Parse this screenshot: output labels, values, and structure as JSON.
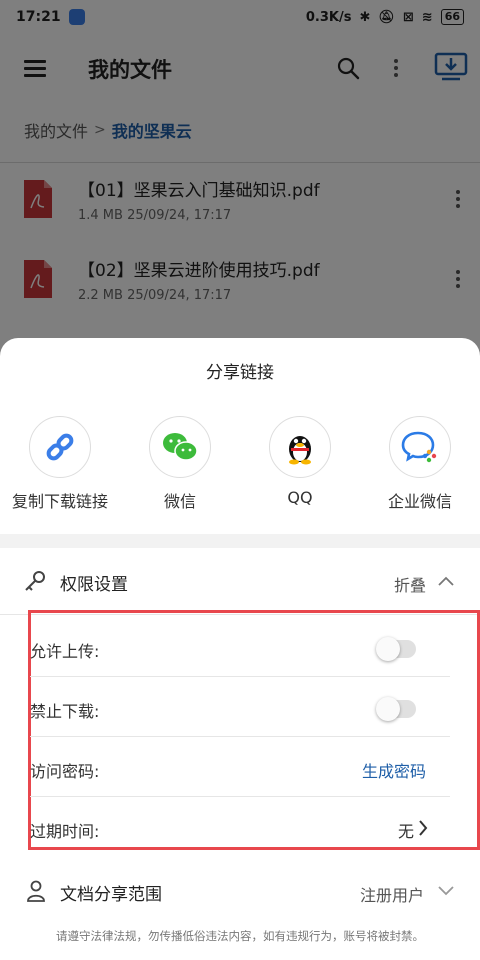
{
  "status_bar": {
    "time": "17:21",
    "net_speed": "0.3K/s",
    "battery": "66"
  },
  "header": {
    "title": "我的文件"
  },
  "breadcrumb": {
    "root": "我的文件",
    "separator": ">",
    "current": "我的坚果云"
  },
  "files": [
    {
      "name": "【01】坚果云入门基础知识.pdf",
      "meta": "1.4 MB 25/09/24, 17:17"
    },
    {
      "name": "【02】坚果云进阶使用技巧.pdf",
      "meta": "2.2 MB 25/09/24, 17:17"
    }
  ],
  "share_sheet": {
    "title": "分享链接",
    "targets": [
      {
        "label": "复制下载链接",
        "icon": "link-icon"
      },
      {
        "label": "微信",
        "icon": "wechat-icon"
      },
      {
        "label": "QQ",
        "icon": "qq-icon"
      },
      {
        "label": "企业微信",
        "icon": "wecom-icon"
      }
    ],
    "permissions": {
      "title": "权限设置",
      "collapse_label": "折叠",
      "rows": {
        "allow_upload": {
          "label": "允许上传:",
          "enabled": false
        },
        "forbid_download": {
          "label": "禁止下载:",
          "enabled": false
        },
        "password": {
          "label": "访问密码:",
          "action": "生成密码"
        },
        "expiry": {
          "label": "过期时间:",
          "value": "无"
        }
      }
    },
    "scope": {
      "title": "文档分享范围",
      "value": "注册用户"
    },
    "notice": "请遵守法律法规，勿传播低俗违法内容，如有违规行为，账号将被封禁。"
  },
  "colors": {
    "accent": "#1f5fa8",
    "highlight_border": "#e8474d",
    "pdf_red": "#c8373a"
  }
}
